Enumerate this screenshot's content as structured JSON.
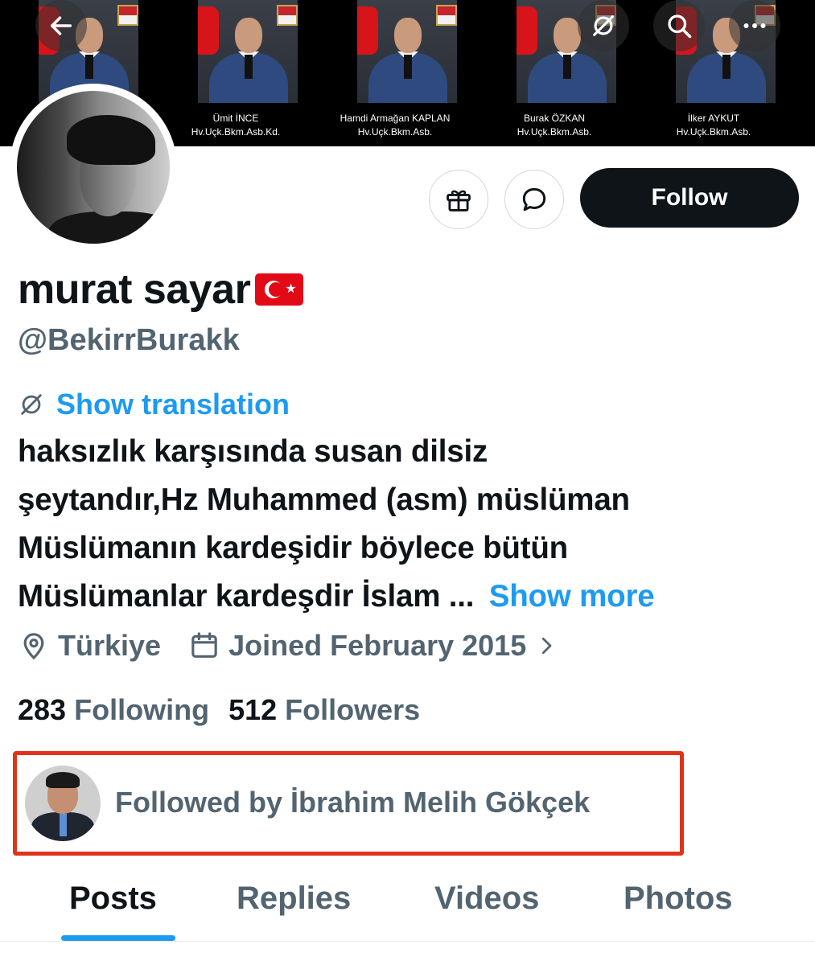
{
  "banner": {
    "portraits": [
      {
        "name": "",
        "rank": "",
        "extra": ""
      },
      {
        "name": "Ümit İNCE",
        "rank": "Hv.Uçk.Bkm.Asb.Kd.",
        "extra": ""
      },
      {
        "name": "Hamdi Armağan KAPLAN",
        "rank": "Hv.Uçk.Bkm.Asb.",
        "extra": ""
      },
      {
        "name": "Burak ÖZKAN",
        "rank": "Hv.Uçk.Bkm.Asb.",
        "extra": ""
      },
      {
        "name": "İlker AYKUT",
        "rank": "Hv.Uçk.Bkm.Asb.",
        "extra": ""
      }
    ]
  },
  "header_buttons": {
    "back": "back-arrow-icon",
    "translate": "translate-icon",
    "search": "search-icon",
    "more": "more-icon"
  },
  "actions": {
    "gift": "gift-icon",
    "message": "message-icon",
    "follow_label": "Follow"
  },
  "profile": {
    "display_name": "murat sayar",
    "handle": "@BekirrBurakk",
    "show_translation": "Show translation",
    "bio_lines": [
      "haksızlık karşısında susan dilsiz",
      "şeytandır,Hz Muhammed (asm) müslüman",
      "Müslümanın kardeşidir böylece bütün",
      "Müslümanlar kardeşdir İslam ..."
    ],
    "show_more": "Show more",
    "location": "Türkiye",
    "joined": "Joined February 2015"
  },
  "stats": {
    "following_count": "283",
    "following_label": "Following",
    "followers_count": "512",
    "followers_label": "Followers"
  },
  "followed_by": {
    "text": "Followed by İbrahim Melih Gökçek"
  },
  "tabs": [
    {
      "label": "Posts",
      "active": true
    },
    {
      "label": "Replies",
      "active": false
    },
    {
      "label": "Videos",
      "active": false
    },
    {
      "label": "Photos",
      "active": false
    }
  ],
  "colors": {
    "accent": "#1d9bf0",
    "text_primary": "#0f1419",
    "text_secondary": "#536471",
    "highlight_box": "#e0341a",
    "flag_red": "#e30a17"
  }
}
